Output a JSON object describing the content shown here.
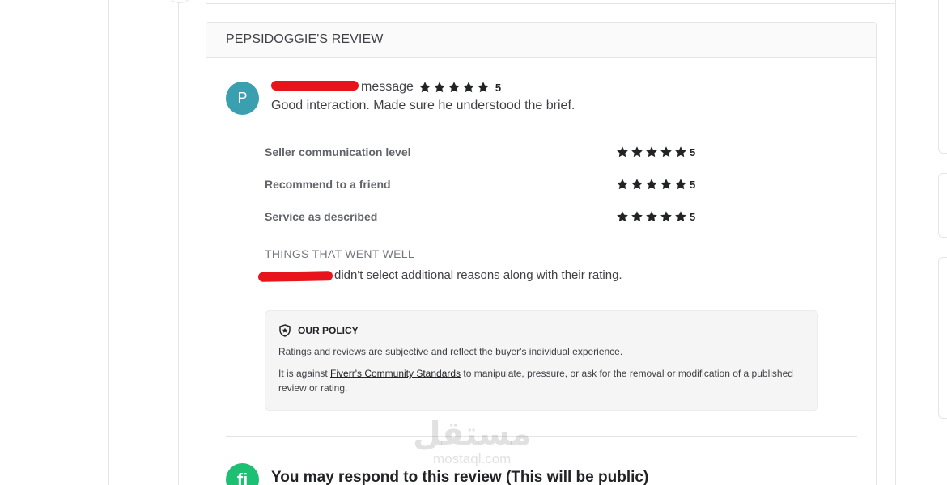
{
  "review": {
    "header_title": "PEPSIDOGGIE'S REVIEW",
    "avatar_letter": "P",
    "source": "message",
    "rating": "5",
    "text": "Good interaction. Made sure he understood the brief."
  },
  "ratings": [
    {
      "label": "Seller communication level",
      "value": "5"
    },
    {
      "label": "Recommend to a friend",
      "value": "5"
    },
    {
      "label": "Service as described",
      "value": "5"
    }
  ],
  "went_well": {
    "title": "THINGS THAT WENT WELL",
    "text": "didn't select additional reasons along with their rating."
  },
  "policy": {
    "title": "OUR POLICY",
    "p1": "Ratings and reviews are subjective and reflect the buyer's individual experience.",
    "p2_before": "It is against ",
    "p2_link": "Fiverr's Community Standards",
    "p2_after": " to manipulate, pressure, or ask for the removal or modification of a published review or rating."
  },
  "respond": {
    "logo": "fi",
    "title": "You may respond to this review (This will be public)"
  },
  "watermark": {
    "arabic": "مستقل",
    "latin": "mostaql.com"
  },
  "icons": {
    "star": "star-icon",
    "policy": "shield-icon"
  },
  "colors": {
    "avatar": "#3a9faf",
    "redaction": "#e8141b",
    "fiverr_green": "#1dbf73",
    "star": "#222325"
  }
}
